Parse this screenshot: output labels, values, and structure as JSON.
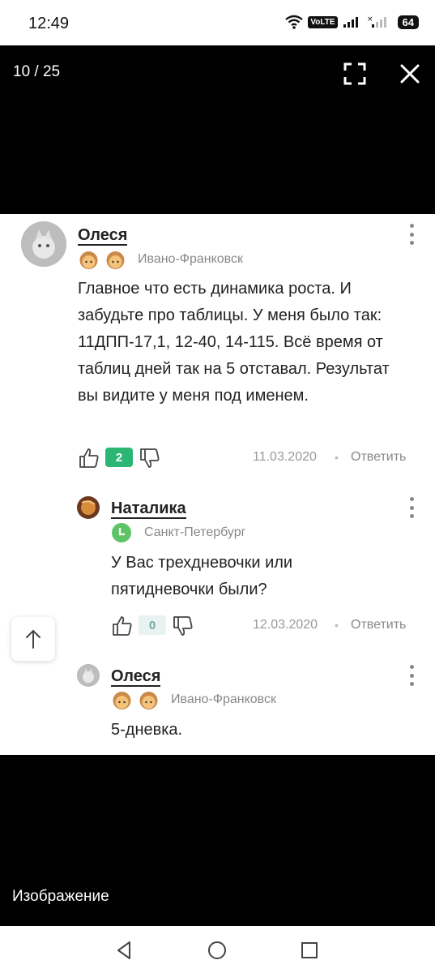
{
  "status_bar": {
    "time": "12:49",
    "network_label": "VoLTE",
    "battery": "64"
  },
  "viewer": {
    "counter": "10 / 25",
    "caption": "Изображение"
  },
  "comments": [
    {
      "user": "Олеся",
      "city": "Ивано-Франковск",
      "text": "Главное что есть динамика роста. И забудьте про таблицы. У меня было так: 11ДПП-17,1, 12-40, 14-115. Всё время от таблиц дней так на 5 отставал. Результат вы видите у меня под именем.",
      "score": "2",
      "date": "11.03.2020",
      "reply_label": "Ответить"
    },
    {
      "user": "Наталика",
      "city": "Санкт-Петербург",
      "text": "У Вас трехдневочки или пятидневочки были?",
      "score": "0",
      "date": "12.03.2020",
      "reply_label": "Ответить"
    },
    {
      "user": "Олеся",
      "city": "Ивано-Франковск",
      "text": "5-дневка."
    }
  ],
  "colors": {
    "score_positive_bg": "#2bb673",
    "score_zero_bg": "#e6f3f0",
    "score_zero_text": "#7aa89a",
    "badge_green": "#5cc466"
  },
  "icons": [
    "wifi-icon",
    "signal-icon",
    "fullscreen-icon",
    "close-icon",
    "thumbs-up-icon",
    "thumbs-down-icon",
    "more-icon",
    "arrow-up-icon",
    "back-icon",
    "home-icon",
    "recents-icon"
  ]
}
